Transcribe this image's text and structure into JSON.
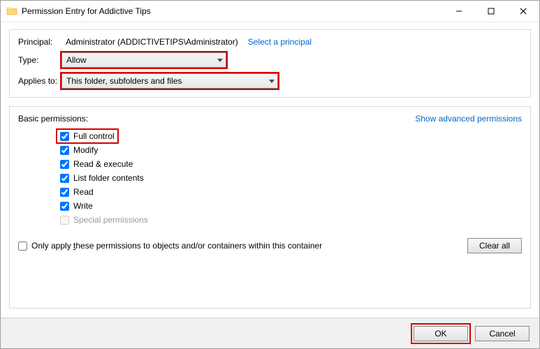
{
  "window": {
    "title": "Permission Entry for Addictive Tips"
  },
  "panel1": {
    "principal_label": "Principal:",
    "principal_value": "Administrator (ADDICTIVETIPS\\Administrator)",
    "select_principal": "Select a principal",
    "type_label": "Type:",
    "type_value": "Allow",
    "applies_label": "Applies to:",
    "applies_value": "This folder, subfolders and files"
  },
  "panel2": {
    "basic_label": "Basic permissions:",
    "adv_link": "Show advanced permissions",
    "items": {
      "full_control": "Full control",
      "modify": "Modify",
      "read_execute": "Read & execute",
      "list_contents": "List folder contents",
      "read": "Read",
      "write": "Write",
      "special": "Special permissions"
    },
    "only_apply": "Only apply these permissions to objects and/or containers within this container",
    "clear_all": "Clear all"
  },
  "footer": {
    "ok": "OK",
    "cancel": "Cancel"
  }
}
